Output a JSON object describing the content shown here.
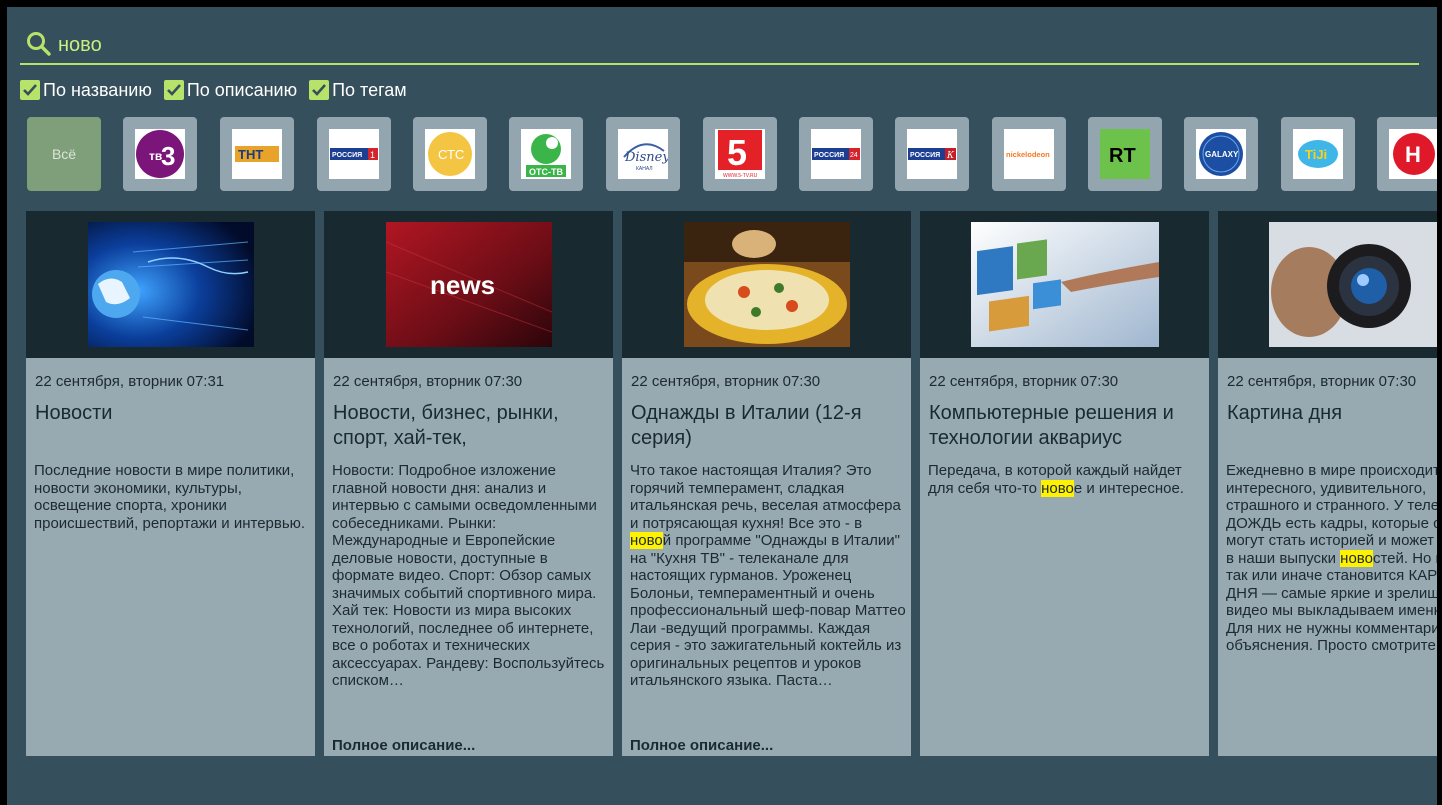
{
  "search": {
    "query": "ново",
    "underline_color": "#b7e36a"
  },
  "filters": [
    {
      "label": "По названию",
      "checked": true
    },
    {
      "label": "По описанию",
      "checked": true
    },
    {
      "label": "По тегам",
      "checked": true
    }
  ],
  "channels": {
    "all_label": "Всё",
    "logos": [
      {
        "icon": "tv3-logo",
        "text": "ТВ3"
      },
      {
        "icon": "tnt-logo",
        "text": "ТНТ"
      },
      {
        "icon": "russia1-logo",
        "text": "РОССИЯ 1"
      },
      {
        "icon": "sts-logo",
        "text": "СТС"
      },
      {
        "icon": "ots-logo",
        "text": "ОТС-ТВ"
      },
      {
        "icon": "disney-logo",
        "text": "Disney"
      },
      {
        "icon": "channel5-logo",
        "text": "5"
      },
      {
        "icon": "russia24-logo",
        "text": "РОССИЯ 24"
      },
      {
        "icon": "russia-k-logo",
        "text": "РОССИЯ К"
      },
      {
        "icon": "nickelodeon-logo",
        "text": "nickelodeon"
      },
      {
        "icon": "rt-logo",
        "text": "RT"
      },
      {
        "icon": "galaxy-logo",
        "text": "GALAXY"
      },
      {
        "icon": "tiji-logo",
        "text": "TiJi"
      },
      {
        "icon": "h-logo",
        "text": "Н"
      }
    ]
  },
  "cards": [
    {
      "date": "22 сентября, вторник 07:31",
      "title": "Новости",
      "desc_parts": [
        "Последние новости в мире политики, новости экономики, культуры, освещение спорта, хроники происшествий, репортажи и интервью."
      ],
      "more": ""
    },
    {
      "date": "22 сентября, вторник 07:30",
      "title": "Новости, бизнес, рынки, спорт, хай-тек,",
      "thumb_text": "news",
      "desc_parts": [
        "Новости: Подробное изложение главной новости дня: анализ и интервью с самыми осведомленными собеседниками. Рынки: Международные и Европейские деловые новости, доступные в формате видео. Спорт: Обзор самых значимых событий спортивного мира. Хай тек: Новости из мира высоких технологий, последнее об интернете, все о роботах и технических аксессуарах. Рандеву: Воспользуйтесь списком…"
      ],
      "more": "Полное описание..."
    },
    {
      "date": "22 сентября, вторник 07:30",
      "title": "Однажды в Италии (12-я серия)",
      "desc_parts": [
        "Что такое настоящая Италия? Это горячий темперамент, сладкая итальянская речь, веселая атмосфера и потрясающая кухня! Все это - в ",
        "ново",
        "й программе \"Однажды в Италии\" на \"Кухня ТВ\" - телеканале для настоящих гурманов. Уроженец Болоньи, темпераментный и очень профессиональный шеф-повар  Маттео Лаи -ведущий программы. Каждая серия - это зажигательный коктейль из оригинальных рецептов и уроков итальянского языка. Паста…"
      ],
      "more": "Полное описание..."
    },
    {
      "date": "22 сентября, вторник 07:30",
      "title": "Компьютерные решения и технологии аквариус",
      "desc_parts": [
        "Передача, в которой каждый найдет для себя что-то ",
        "ново",
        "е и интересное."
      ],
      "more": ""
    },
    {
      "date": "22 сентября, вторник 07:30",
      "title": "Картина дня",
      "desc_parts": [
        "Ежедневно в мире происходит интересного, удивительного, страшного и странного. У телеканала ДОЖДЬ есть кадры, которые скоро могут стать историей и может попасть в наши выпуски ",
        "ново",
        "стей. Но все это так или иначе становится КАРТИНОЙ ДНЯ — самые яркие и зрелищные видео мы выкладываем именно здесь. Для них не нужны комментарии и объяснения. Просто смотрите!"
      ],
      "more": ""
    }
  ]
}
